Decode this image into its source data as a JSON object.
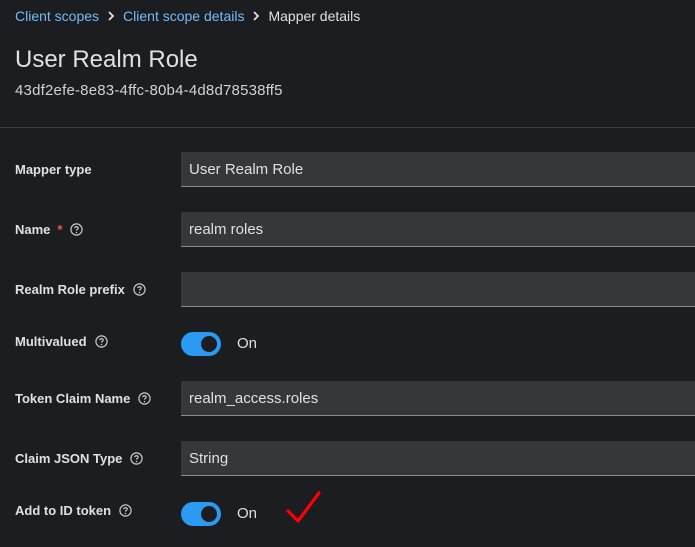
{
  "breadcrumb": {
    "items": [
      "Client scopes",
      "Client scope details"
    ],
    "current": "Mapper details"
  },
  "header": {
    "title": "User Realm Role",
    "id": "43df2efe-8e83-4ffc-80b4-4d8d78538ff5"
  },
  "form": {
    "mapper_type": {
      "label": "Mapper type",
      "value": "User Realm Role"
    },
    "name": {
      "label": "Name",
      "required_mark": "*",
      "value": "realm roles"
    },
    "realm_role_prefix": {
      "label": "Realm Role prefix",
      "value": ""
    },
    "multivalued": {
      "label": "Multivalued",
      "state": "On",
      "checked": true
    },
    "token_claim_name": {
      "label": "Token Claim Name",
      "value": "realm_access.roles"
    },
    "claim_json_type": {
      "label": "Claim JSON Type",
      "value": "String"
    },
    "add_to_id_token": {
      "label": "Add to ID token",
      "state": "On",
      "checked": true
    }
  },
  "icons": {
    "help": "help-circle-icon",
    "separator": "chevron-right-icon",
    "annotation": "red-checkmark-icon"
  },
  "colors": {
    "link": "#73bcf7",
    "switch_on": "#2b9af3",
    "required": "#fe5142",
    "annotation": "#ff0000"
  }
}
